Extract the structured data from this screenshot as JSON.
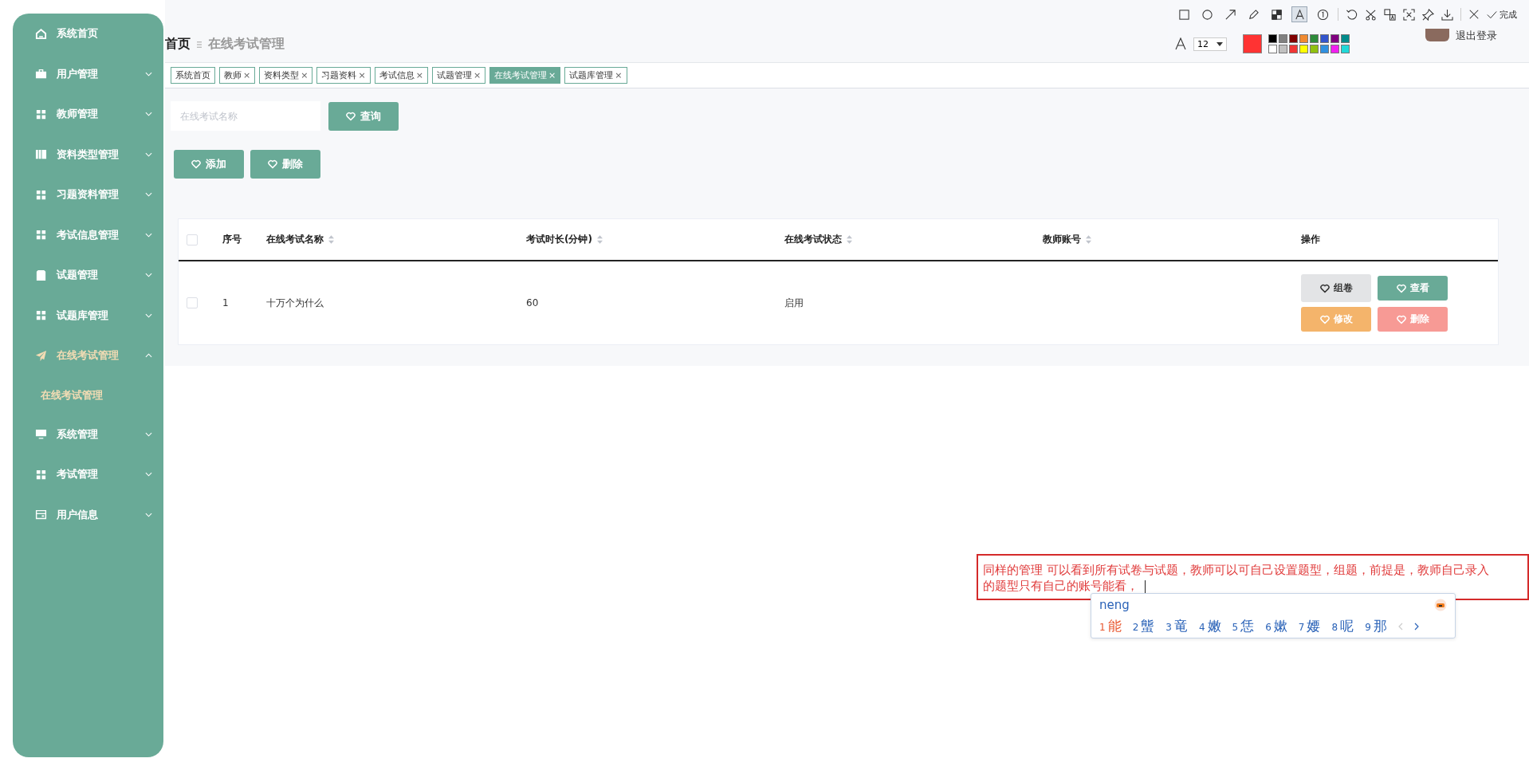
{
  "sidebar": {
    "items": [
      {
        "label": "系统首页",
        "kind": "link",
        "selected": false
      },
      {
        "label": "用户管理",
        "kind": "menu",
        "selected": false,
        "expanded": false
      },
      {
        "label": "教师管理",
        "kind": "menu",
        "selected": false,
        "expanded": false
      },
      {
        "label": "资料类型管理",
        "kind": "menu",
        "selected": false,
        "expanded": false
      },
      {
        "label": "习题资料管理",
        "kind": "menu",
        "selected": false,
        "expanded": false
      },
      {
        "label": "考试信息管理",
        "kind": "menu",
        "selected": false,
        "expanded": false
      },
      {
        "label": "试题管理",
        "kind": "menu",
        "selected": false,
        "expanded": false
      },
      {
        "label": "试题库管理",
        "kind": "menu",
        "selected": false,
        "expanded": false
      },
      {
        "label": "在线考试管理",
        "kind": "menu",
        "selected": true,
        "expanded": true,
        "children": [
          {
            "label": "在线考试管理",
            "selected": true
          }
        ]
      },
      {
        "label": "系统管理",
        "kind": "menu",
        "selected": false,
        "expanded": false
      },
      {
        "label": "考试管理",
        "kind": "menu",
        "selected": false,
        "expanded": false
      },
      {
        "label": "用户信息",
        "kind": "menu",
        "selected": false,
        "expanded": false
      }
    ]
  },
  "breadcrumb": {
    "home": "首页",
    "current": "在线考试管理"
  },
  "user": {
    "logout": "退出登录"
  },
  "tabs": [
    {
      "label": "系统首页",
      "selected": false
    },
    {
      "label": "教师",
      "close": "×",
      "selected": false
    },
    {
      "label": "资料类型",
      "close": "×",
      "selected": false
    },
    {
      "label": "习题资料",
      "close": "×",
      "selected": false
    },
    {
      "label": "考试信息",
      "close": "×",
      "selected": false
    },
    {
      "label": "试题管理",
      "close": "×",
      "selected": false
    },
    {
      "label": "在线考试管理",
      "close": "×",
      "selected": true
    },
    {
      "label": "试题库管理",
      "close": "×",
      "selected": false
    }
  ],
  "search": {
    "placeholder": "在线考试名称",
    "button": "查询"
  },
  "actions": [
    "添加",
    "删除"
  ],
  "table": {
    "select_all": {
      "checked": false
    },
    "columns": [
      {
        "label": "序号",
        "sortable": false
      },
      {
        "label": "在线考试名称",
        "sortable": true
      },
      {
        "label": "考试时长(分钟)",
        "sortable": true
      },
      {
        "label": "在线考试状态",
        "sortable": true
      },
      {
        "label": "教师账号",
        "sortable": true
      },
      {
        "label": "操作",
        "sortable": false
      }
    ],
    "rows": [
      {
        "checked": false,
        "cells": [
          "1",
          "十万个为什么",
          "60",
          "启用"
        ],
        "actions": [
          {
            "label": "组卷",
            "kind": "neutral"
          },
          {
            "label": "查看",
            "kind": "primary"
          },
          {
            "label": "修改",
            "kind": "warning"
          },
          {
            "label": "删除",
            "kind": "danger"
          }
        ]
      }
    ]
  },
  "screenshot_tool": {
    "tools": [
      {
        "selected": false
      },
      {
        "selected": false
      },
      {
        "selected": false
      },
      {
        "selected": false
      },
      {
        "selected": false
      },
      {
        "selected": true
      },
      {
        "selected": false
      }
    ],
    "done": "完成",
    "font_size": "12",
    "palette": [
      {
        "color": "#000000"
      },
      {
        "color": "#808080"
      },
      {
        "color": "#800000"
      },
      {
        "color": "#f08a30"
      },
      {
        "color": "#2e8b3a"
      },
      {
        "color": "#3355cc"
      },
      {
        "color": "#800080"
      },
      {
        "color": "#008b8b"
      },
      {
        "color": "#ffffff"
      },
      {
        "color": "#c0c0c0"
      },
      {
        "color": "#f03535"
      },
      {
        "color": "#ffff00"
      },
      {
        "color": "#90c010"
      },
      {
        "color": "#3090e0"
      },
      {
        "color": "#f020f0"
      },
      {
        "color": "#20d8d8"
      }
    ]
  },
  "annotation": {
    "text": "同样的管理 可以看到所有试卷与试题，教师可以可自己设置题型，组题，前提是，教师自己录入的题型只有自己的账号能看，"
  },
  "ime": {
    "input": "neng",
    "candidates": [
      {
        "number": "1",
        "text": "能",
        "selected": true
      },
      {
        "number": "2",
        "text": "螚",
        "selected": false
      },
      {
        "number": "3",
        "text": "竜",
        "selected": false
      },
      {
        "number": "4",
        "text": "嫩",
        "selected": false
      },
      {
        "number": "5",
        "text": "恁",
        "selected": false
      },
      {
        "number": "6",
        "text": "嫰",
        "selected": false
      },
      {
        "number": "7",
        "text": "婹",
        "selected": false
      },
      {
        "number": "8",
        "text": "呢",
        "selected": false
      },
      {
        "number": "9",
        "text": "那",
        "selected": false
      }
    ]
  }
}
